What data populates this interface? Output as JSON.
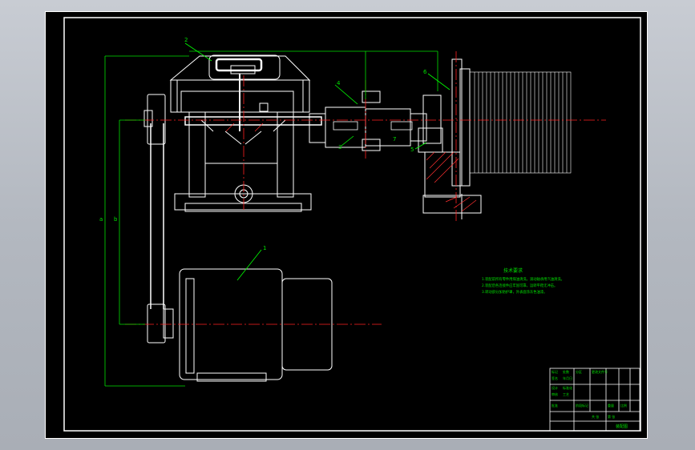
{
  "drawing": {
    "part_labels": [
      "1",
      "2",
      "3",
      "4",
      "5",
      "6",
      "7"
    ],
    "dimension_labels": [
      "a",
      "b"
    ],
    "notes": {
      "title": "技术要求",
      "lines": [
        "1.装配前所有零件用煤油清洗，滚动轴承用汽油清洗。",
        "2.装配后各连接件应牢固可靠，运转平稳无冲击。",
        "3.转动部分加防护罩，外表面涂灰色油漆。"
      ]
    },
    "title_block": {
      "cells": [
        "标记",
        "处数",
        "分区",
        "更改文件号",
        "签名",
        "年月日",
        "设计",
        "标准化",
        "审核",
        "工艺",
        "批准",
        "阶段标记",
        "重量",
        "比例",
        "共 张",
        "第 张"
      ],
      "drawing_name": "装配图"
    },
    "colors": {
      "background": "#000000",
      "outline": "#ffffff",
      "dimension": "#00e000",
      "centerline": "#ff2020",
      "callout": "#00ff00"
    }
  }
}
